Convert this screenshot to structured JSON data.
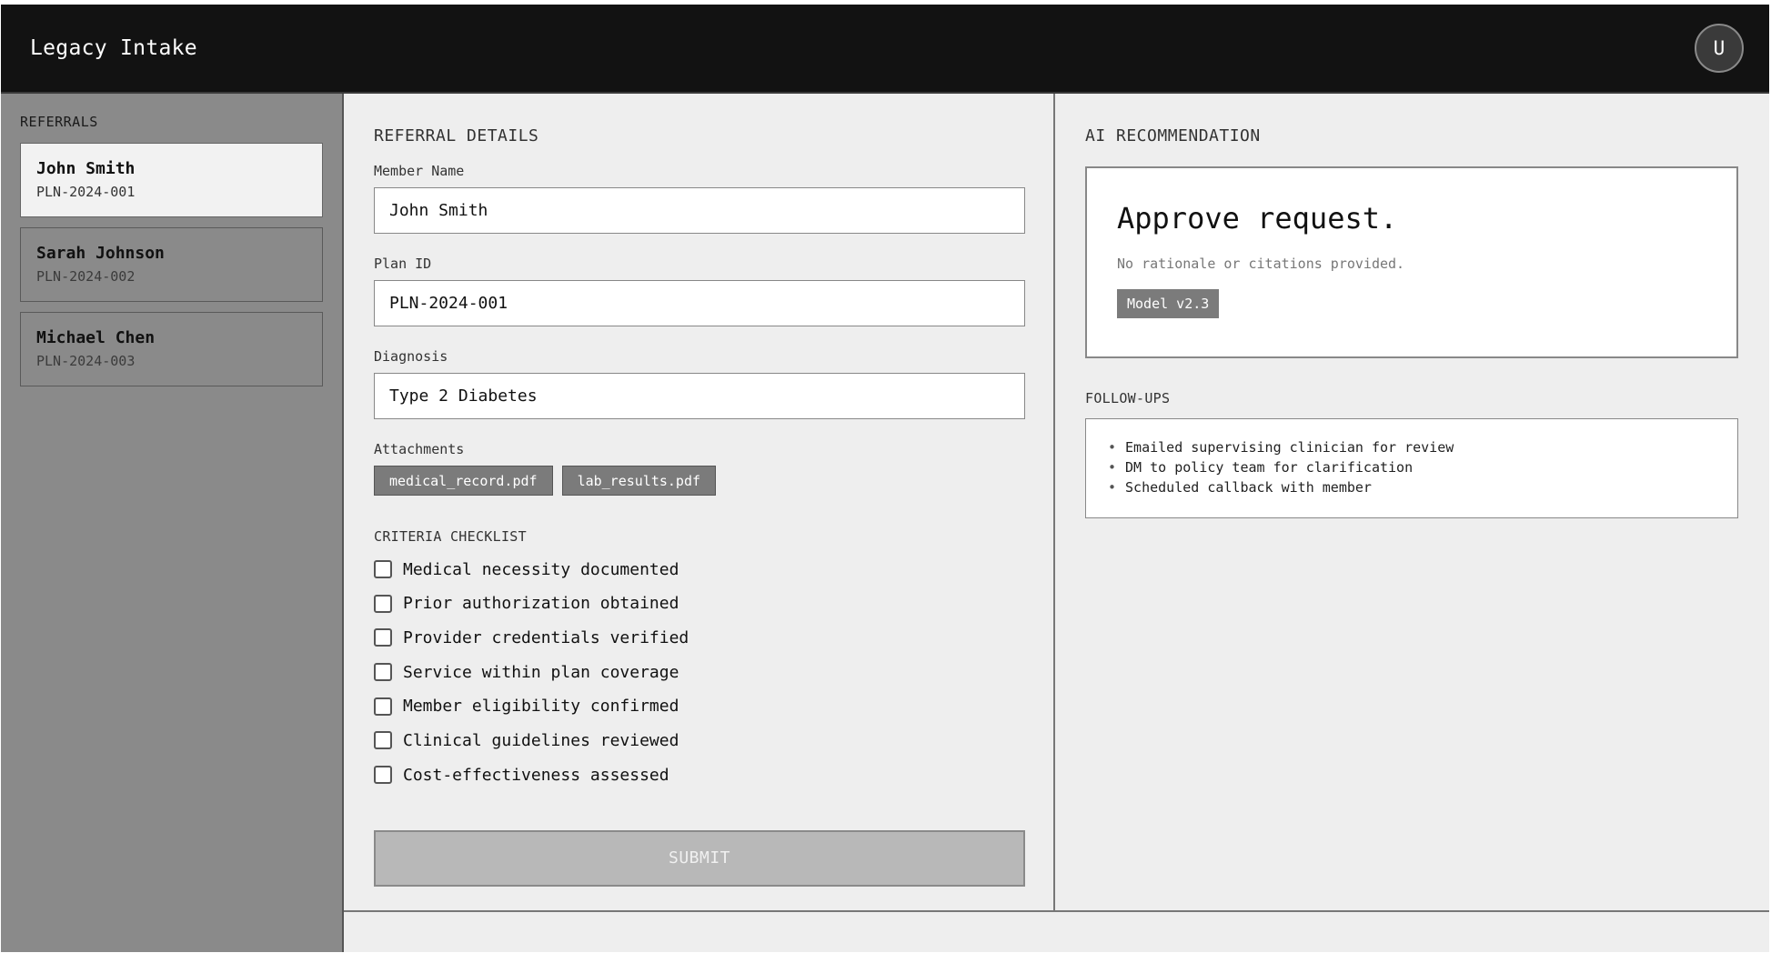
{
  "header": {
    "title": "Legacy Intake",
    "avatar_initial": "U"
  },
  "sidebar": {
    "title": "REFERRALS",
    "items": [
      {
        "name": "John Smith",
        "id": "PLN-2024-001",
        "active": true
      },
      {
        "name": "Sarah Johnson",
        "id": "PLN-2024-002",
        "active": false
      },
      {
        "name": "Michael Chen",
        "id": "PLN-2024-003",
        "active": false
      }
    ]
  },
  "details": {
    "title": "REFERRAL DETAILS",
    "member_name_label": "Member Name",
    "member_name_value": "John Smith",
    "plan_id_label": "Plan ID",
    "plan_id_value": "PLN-2024-001",
    "diagnosis_label": "Diagnosis",
    "diagnosis_value": "Type 2 Diabetes",
    "attachments_label": "Attachments",
    "attachments": [
      "medical_record.pdf",
      "lab_results.pdf"
    ],
    "criteria_title": "CRITERIA CHECKLIST",
    "criteria": [
      "Medical necessity documented",
      "Prior authorization obtained",
      "Provider credentials verified",
      "Service within plan coverage",
      "Member eligibility confirmed",
      "Clinical guidelines reviewed",
      "Cost-effectiveness assessed"
    ],
    "submit_label": "SUBMIT"
  },
  "ai": {
    "title": "AI RECOMMENDATION",
    "recommendation": "Approve request.",
    "note": "No rationale or citations provided.",
    "model_badge": "Model v2.3",
    "followups_title": "FOLLOW-UPS",
    "followups": [
      "Emailed supervising clinician for review",
      "DM to policy team for clarification",
      "Scheduled callback with member"
    ]
  },
  "colors": {
    "header_bg": "#121212",
    "sidebar_bg": "#8a8a8a",
    "panel_bg": "#eeeeee",
    "chip_bg": "#7b7b7b",
    "submit_disabled_bg": "#b8b8b8"
  }
}
